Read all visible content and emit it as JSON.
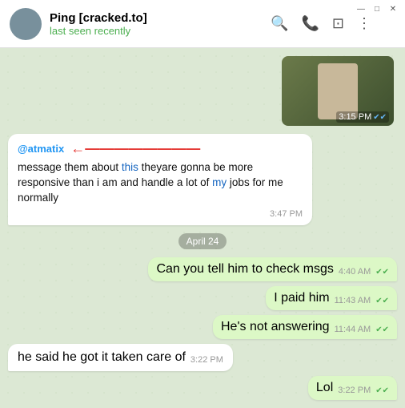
{
  "window": {
    "title": "Ping [cracked.to]",
    "status": "last seen recently",
    "chrome": {
      "minimize": "—",
      "maximize": "□",
      "close": "✕"
    }
  },
  "header": {
    "actions": {
      "search": "🔍",
      "call": "📞",
      "layout": "⊡",
      "more": "⋮"
    }
  },
  "messages": [
    {
      "type": "video",
      "time": "3:15 PM",
      "ticks": "✔✔"
    },
    {
      "type": "received",
      "mention": "@atmatix",
      "arrow": "←",
      "text_parts": [
        {
          "text": "message them about ",
          "highlight": false
        },
        {
          "text": "this ",
          "highlight": true
        },
        {
          "text": "theyare gonna be more responsive than i am and handle a lot of ",
          "highlight": false
        },
        {
          "text": "my",
          "highlight": true
        },
        {
          "text": " jobs for me normally",
          "highlight": false
        }
      ],
      "time": "3:47 PM"
    },
    {
      "type": "divider",
      "label": "April 24"
    },
    {
      "type": "sent",
      "text": "Can you tell him to check msgs",
      "time": "4:40 AM",
      "ticks": "✔✔"
    },
    {
      "type": "sent",
      "text": "I paid him",
      "time": "11:43 AM",
      "ticks": "✔✔"
    },
    {
      "type": "sent",
      "text": "He's not answering",
      "time": "11:44 AM",
      "ticks": "✔✔"
    },
    {
      "type": "received",
      "text": "he said he got it taken care of",
      "time": "3:22 PM"
    },
    {
      "type": "sent",
      "text": "Lol",
      "time": "3:22 PM",
      "ticks": "✔✔"
    }
  ]
}
